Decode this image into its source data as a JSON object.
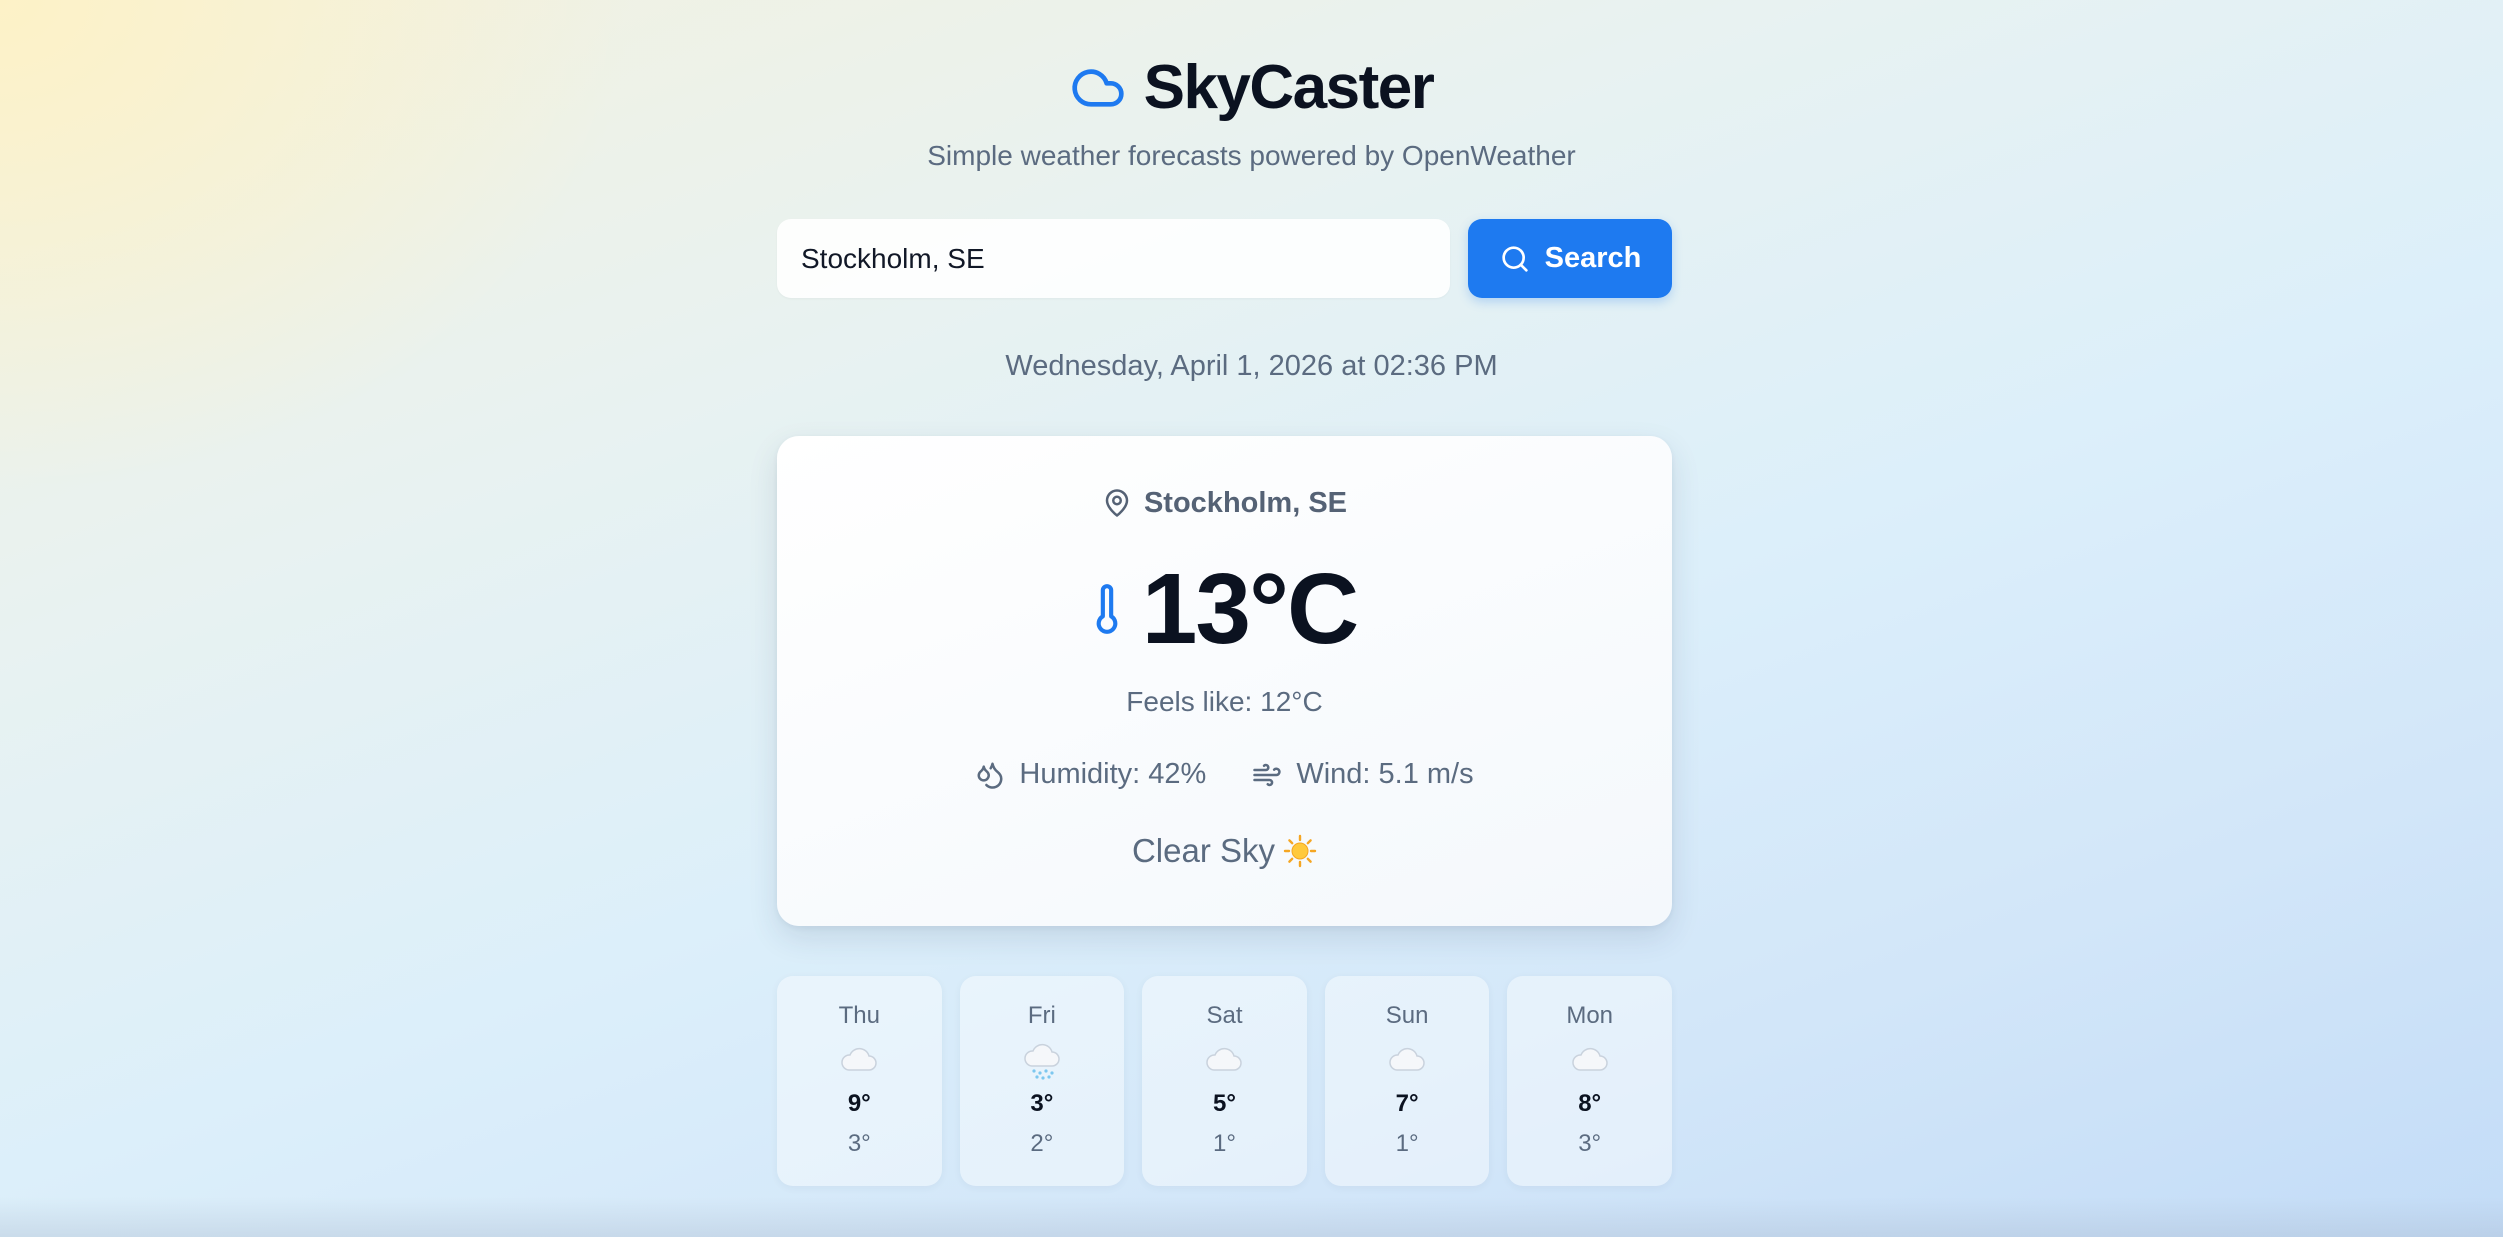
{
  "app": {
    "title": "SkyCaster",
    "subtitle": "Simple weather forecasts powered by OpenWeather",
    "brand_icon": "cloud-icon",
    "accent_color": "#1e7af0"
  },
  "search": {
    "value": "Stockholm, SE",
    "button_label": "Search",
    "button_icon": "search-icon"
  },
  "datetime": "Wednesday, April 1, 2026 at 02:36 PM",
  "current": {
    "location": "Stockholm, SE",
    "location_icon": "map-pin-icon",
    "temperature": "13°C",
    "temperature_icon": "thermometer-icon",
    "feels_like": "Feels like: 12°C",
    "humidity": "Humidity: 42%",
    "humidity_icon": "droplets-icon",
    "wind": "Wind: 5.1 m/s",
    "wind_icon": "wind-icon",
    "condition": "Clear Sky",
    "condition_icon": "sun-icon"
  },
  "forecast": [
    {
      "day": "Thu",
      "icon": "cloud-icon",
      "high": "9°",
      "low": "3°"
    },
    {
      "day": "Fri",
      "icon": "cloud-snow-icon",
      "high": "3°",
      "low": "2°"
    },
    {
      "day": "Sat",
      "icon": "cloud-icon",
      "high": "5°",
      "low": "1°"
    },
    {
      "day": "Sun",
      "icon": "cloud-icon",
      "high": "7°",
      "low": "1°"
    },
    {
      "day": "Mon",
      "icon": "cloud-icon",
      "high": "8°",
      "low": "3°"
    }
  ]
}
